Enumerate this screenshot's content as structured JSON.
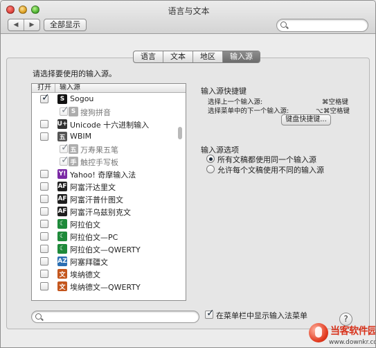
{
  "window": {
    "title": "语言与文本"
  },
  "toolbar": {
    "back": "◀",
    "forward": "▶",
    "show_all": "全部显示",
    "search_placeholder": ""
  },
  "tabs": [
    {
      "label": "语言",
      "active": false
    },
    {
      "label": "文本",
      "active": false
    },
    {
      "label": "地区",
      "active": false
    },
    {
      "label": "输入源",
      "active": true
    }
  ],
  "list": {
    "prompt": "请选择要使用的输入源。",
    "col_enabled": "打开",
    "col_source": "输入源",
    "items": [
      {
        "label": "Sogou",
        "checked": true,
        "sub": false,
        "icon": "S",
        "icon_color": "#111111"
      },
      {
        "label": "搜狗拼音",
        "checked": true,
        "sub": true,
        "icon": "S",
        "icon_color": "#777777"
      },
      {
        "label": "Unicode 十六进制输入",
        "checked": false,
        "sub": false,
        "icon": "U+",
        "icon_color": "#333333"
      },
      {
        "label": "WBIM",
        "checked": false,
        "sub": false,
        "icon": "五",
        "icon_color": "#555555"
      },
      {
        "label": "万寿果五笔",
        "checked": true,
        "sub": true,
        "icon": "五",
        "icon_color": "#777777"
      },
      {
        "label": "触控手写板",
        "checked": true,
        "sub": true,
        "icon": "手",
        "icon_color": "#777777"
      },
      {
        "label": "Yahoo! 奇摩输入法",
        "checked": false,
        "sub": false,
        "icon": "Y!",
        "icon_color": "#7b2aa5"
      },
      {
        "label": "阿富汗达里文",
        "checked": false,
        "sub": false,
        "icon": "AF",
        "icon_color": "#1f1f1f"
      },
      {
        "label": "阿富汗普什图文",
        "checked": false,
        "sub": false,
        "icon": "AF",
        "icon_color": "#1f1f1f"
      },
      {
        "label": "阿富汗乌兹别克文",
        "checked": false,
        "sub": false,
        "icon": "AF",
        "icon_color": "#1f1f1f"
      },
      {
        "label": "阿拉伯文",
        "checked": false,
        "sub": false,
        "icon": "☾",
        "icon_color": "#1e8a3a"
      },
      {
        "label": "阿拉伯文—PC",
        "checked": false,
        "sub": false,
        "icon": "☾",
        "icon_color": "#1e8a3a"
      },
      {
        "label": "阿拉伯文—QWERTY",
        "checked": false,
        "sub": false,
        "icon": "☾",
        "icon_color": "#1e8a3a"
      },
      {
        "label": "阿塞拜疆文",
        "checked": false,
        "sub": false,
        "icon": "AZ",
        "icon_color": "#2b6fb3"
      },
      {
        "label": "埃纳德文",
        "checked": false,
        "sub": false,
        "icon": "文",
        "icon_color": "#c4561d"
      },
      {
        "label": "埃纳德文—QWERTY",
        "checked": false,
        "sub": false,
        "icon": "文",
        "icon_color": "#c4561d"
      }
    ]
  },
  "shortcuts": {
    "heading": "输入源快捷键",
    "prev_label": "选择上一个输入源:",
    "prev_key": "⌘空格键",
    "next_label": "选择菜单中的下一个输入源:",
    "next_key": "⌥⌘空格键",
    "button": "键盘快捷键..."
  },
  "options": {
    "heading": "输入源选项",
    "same": "所有文稿都使用同一个输入源",
    "different": "允许每个文稿使用不同的输入源"
  },
  "bottom": {
    "search_placeholder": "",
    "show_menu_label": "在菜单栏中显示输入法菜单",
    "show_menu_checked": true,
    "help": "?"
  },
  "watermark": {
    "name": "当客软件园",
    "url": "www.downkr.com"
  }
}
